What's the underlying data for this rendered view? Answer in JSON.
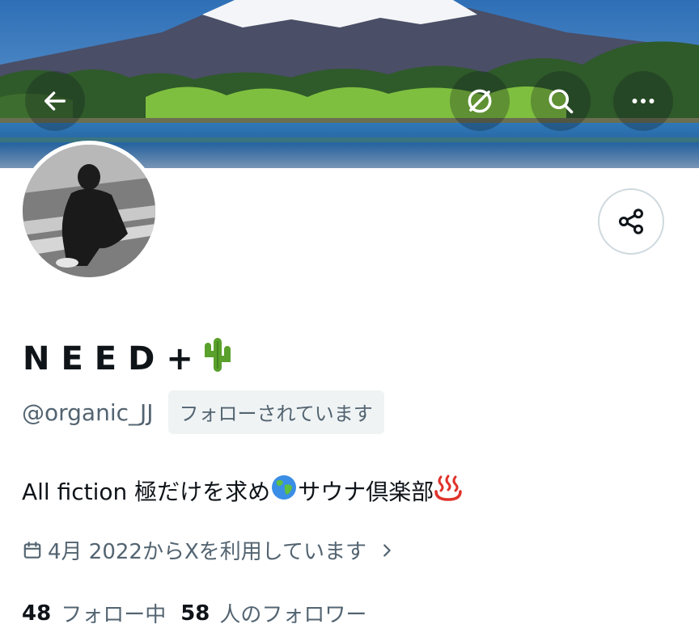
{
  "header": {
    "back_icon": "arrow-left-icon",
    "grok_icon": "grok-icon",
    "search_icon": "search-icon",
    "more_icon": "more-horizontal-icon",
    "banner": "mountain-lake-banner"
  },
  "profile": {
    "display_name": "NEED+",
    "name_emoji": "cactus-emoji",
    "handle": "@organic_JJ",
    "follows_you_badge": "フォローされています",
    "bio_part1": "All fiction 極だけを求め",
    "bio_emoji1": "globe-emoji",
    "bio_part2": "サウナ倶楽部",
    "bio_emoji2": "hot-springs-emoji",
    "joined": "4月 2022からXを利用しています",
    "share_icon": "share-icon"
  },
  "stats": {
    "following_count": "48",
    "following_label": "フォロー中",
    "followers_count": "58",
    "followers_label": "人のフォロワー"
  },
  "colors": {
    "text_primary": "#0f1419",
    "text_secondary": "#536471",
    "badge_bg": "#eff3f4",
    "border": "#cfd9de"
  }
}
